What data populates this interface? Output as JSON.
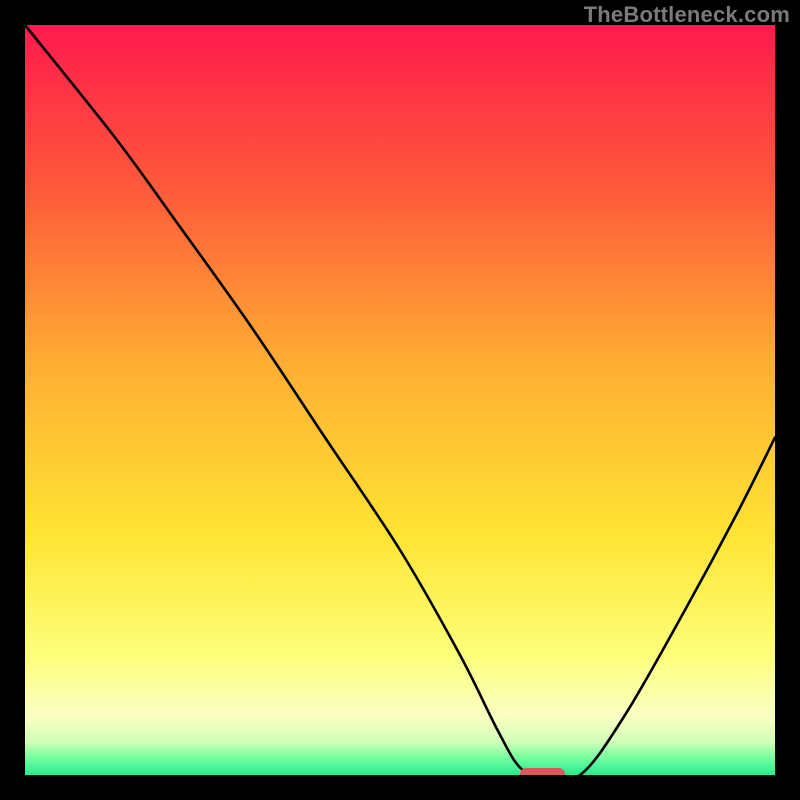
{
  "watermark": "TheBottleneck.com",
  "chart_data": {
    "type": "line",
    "title": "",
    "xlabel": "",
    "ylabel": "",
    "xlim": [
      0,
      100
    ],
    "ylim": [
      0,
      100
    ],
    "grid": false,
    "legend": false,
    "annotations": [],
    "series": [
      {
        "name": "curve",
        "x": [
          0,
          12,
          20,
          30,
          40,
          50,
          58,
          63,
          66,
          69,
          74,
          80,
          88,
          95,
          100
        ],
        "values": [
          100,
          85,
          74,
          60,
          45,
          30,
          16,
          6,
          1,
          0,
          0,
          8,
          22,
          35,
          45
        ]
      }
    ],
    "marker": {
      "name": "optimal-range",
      "x_start": 66,
      "x_end": 72,
      "value": 0,
      "color": "#d85a5a"
    },
    "background": {
      "description": "vertical gradient red→orange→yellow→pale-yellow→spring-green",
      "stops": [
        {
          "offset": 0.0,
          "color": "#ff1a4d"
        },
        {
          "offset": 0.22,
          "color": "#ff5a3a"
        },
        {
          "offset": 0.45,
          "color": "#ffad33"
        },
        {
          "offset": 0.68,
          "color": "#ffe433"
        },
        {
          "offset": 0.84,
          "color": "#feff7a"
        },
        {
          "offset": 0.92,
          "color": "#faffc2"
        },
        {
          "offset": 0.955,
          "color": "#d3ffb8"
        },
        {
          "offset": 0.975,
          "color": "#7dffa0"
        },
        {
          "offset": 1.0,
          "color": "#22ee90"
        }
      ]
    }
  }
}
